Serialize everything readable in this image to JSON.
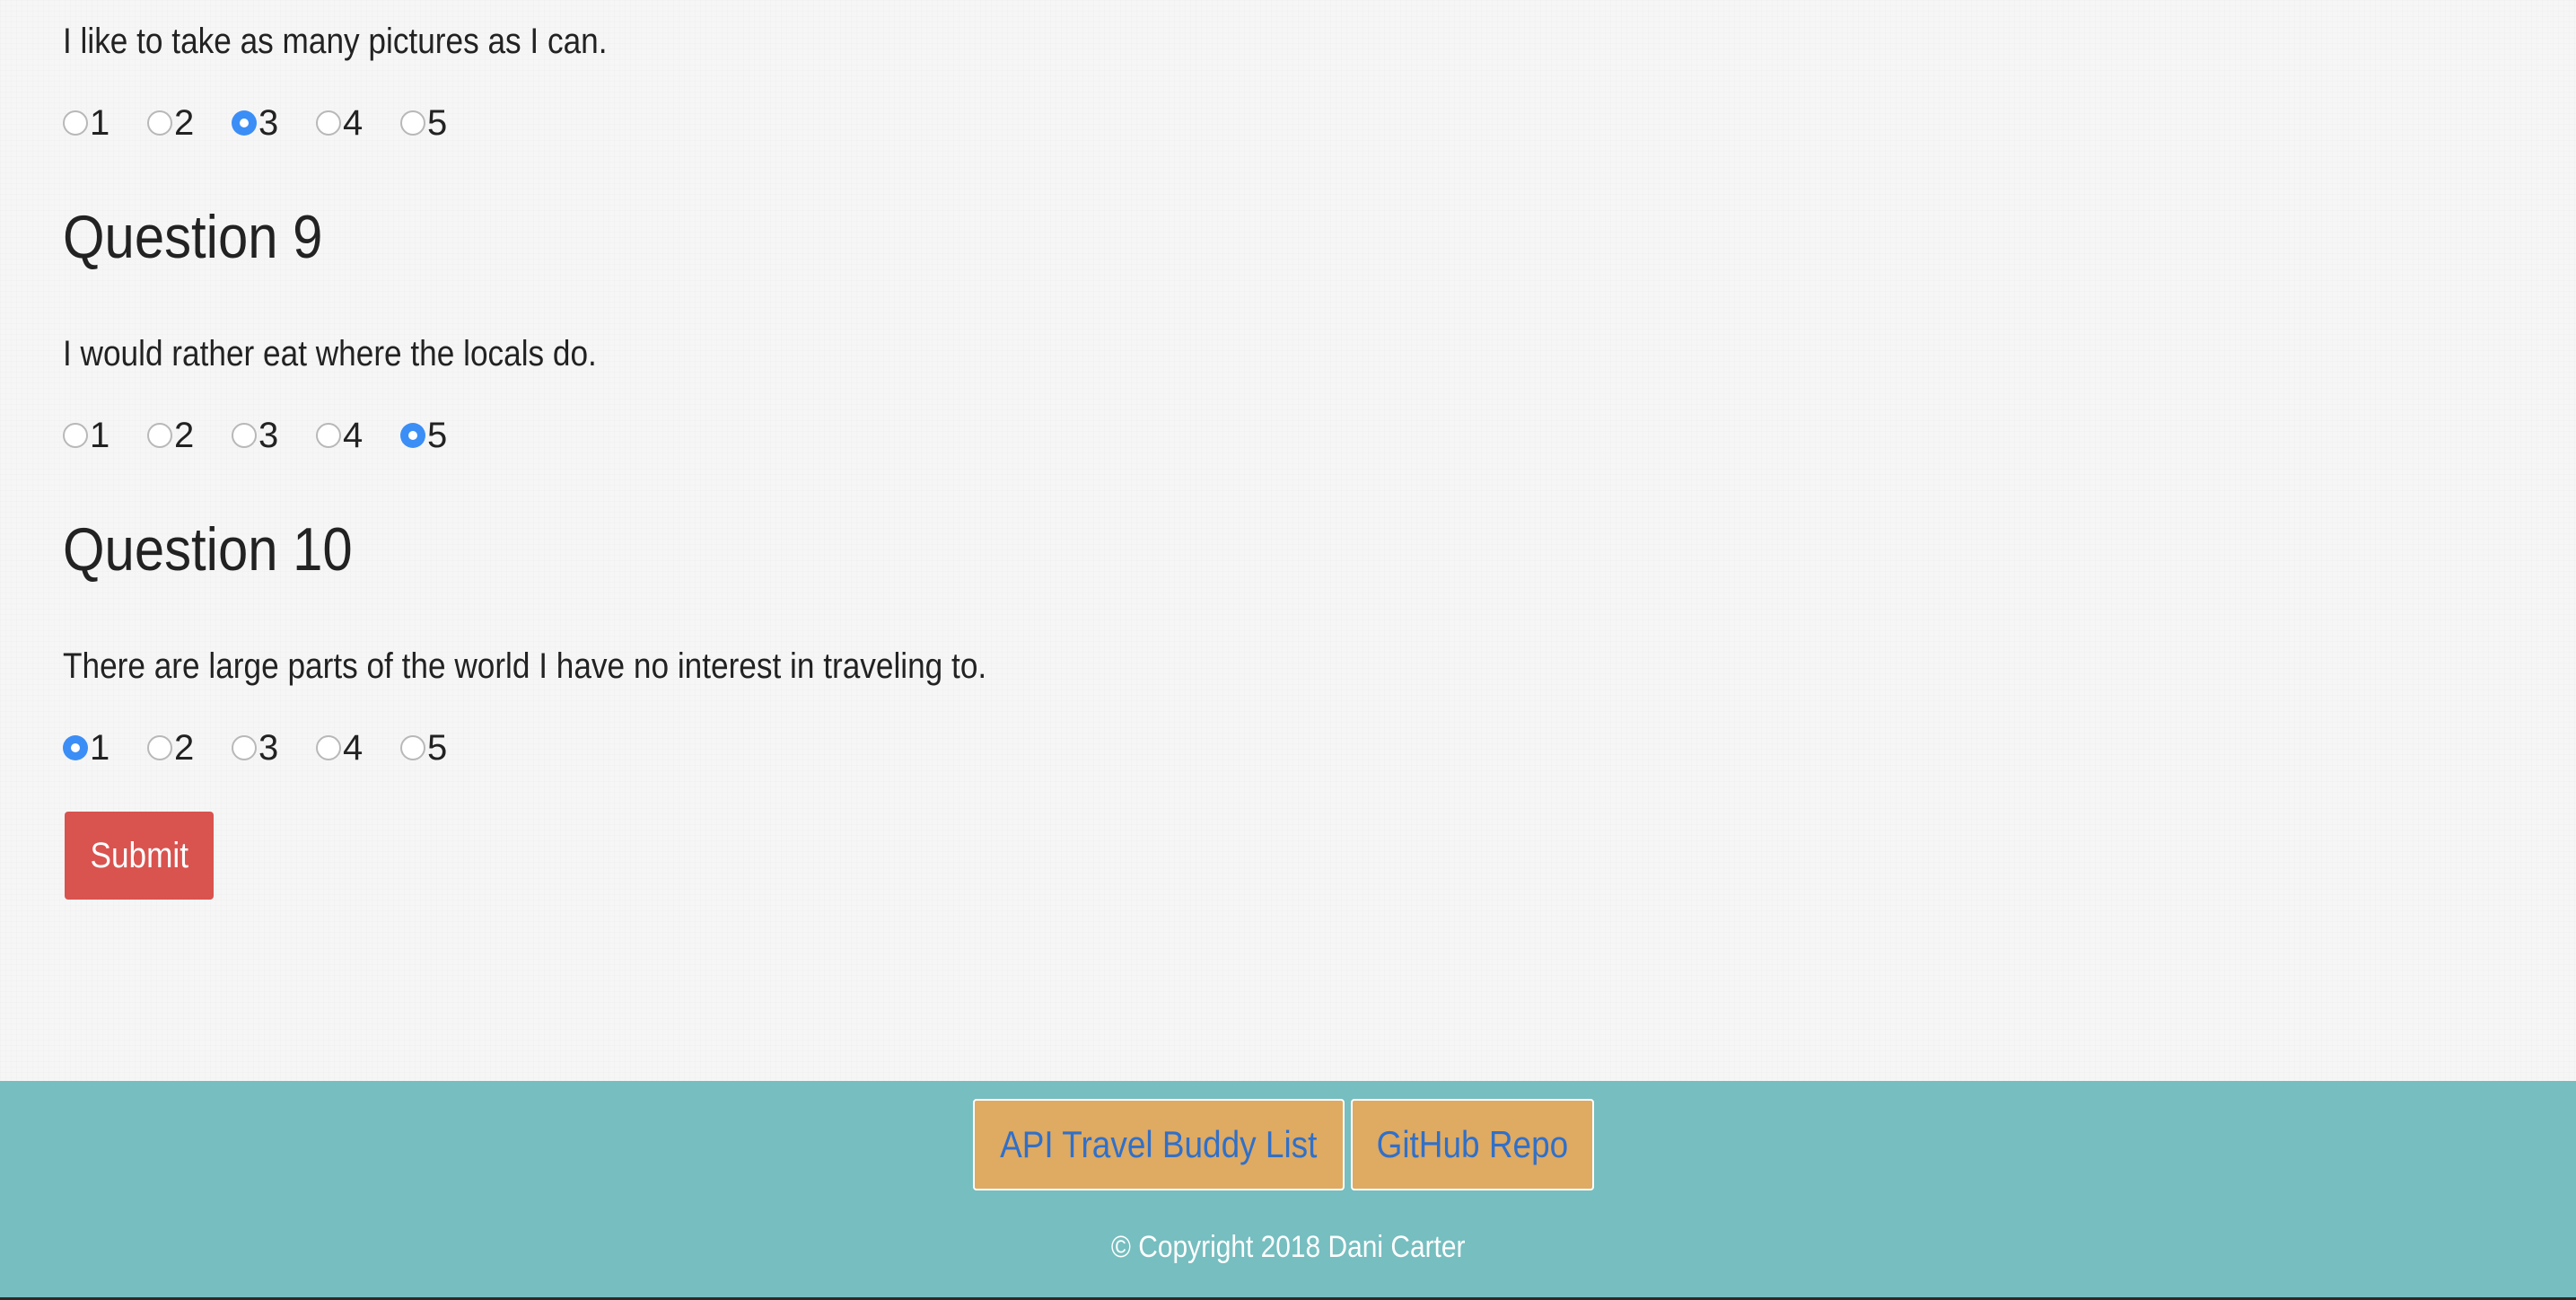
{
  "questions": [
    {
      "heading": "",
      "prompt": "I like to take as many pictures as I can.",
      "options": [
        "1",
        "2",
        "3",
        "4",
        "5"
      ],
      "selected": "3"
    },
    {
      "heading": "Question 9",
      "prompt": "I would rather eat where the locals do.",
      "options": [
        "1",
        "2",
        "3",
        "4",
        "5"
      ],
      "selected": "5"
    },
    {
      "heading": "Question 10",
      "prompt": "There are large parts of the world I have no interest in traveling to.",
      "options": [
        "1",
        "2",
        "3",
        "4",
        "5"
      ],
      "selected": "1"
    }
  ],
  "form": {
    "submit_label": "Submit"
  },
  "footer": {
    "links": [
      {
        "label": "API Travel Buddy List"
      },
      {
        "label": "GitHub Repo"
      }
    ],
    "copyright": "© Copyright 2018 Dani Carter"
  },
  "colors": {
    "footer_background": "#76bec0",
    "footer_button": "#dfaa62",
    "link_text": "#3070c9",
    "submit_button": "#d9534f",
    "radio_selected": "#3b8ef6"
  }
}
